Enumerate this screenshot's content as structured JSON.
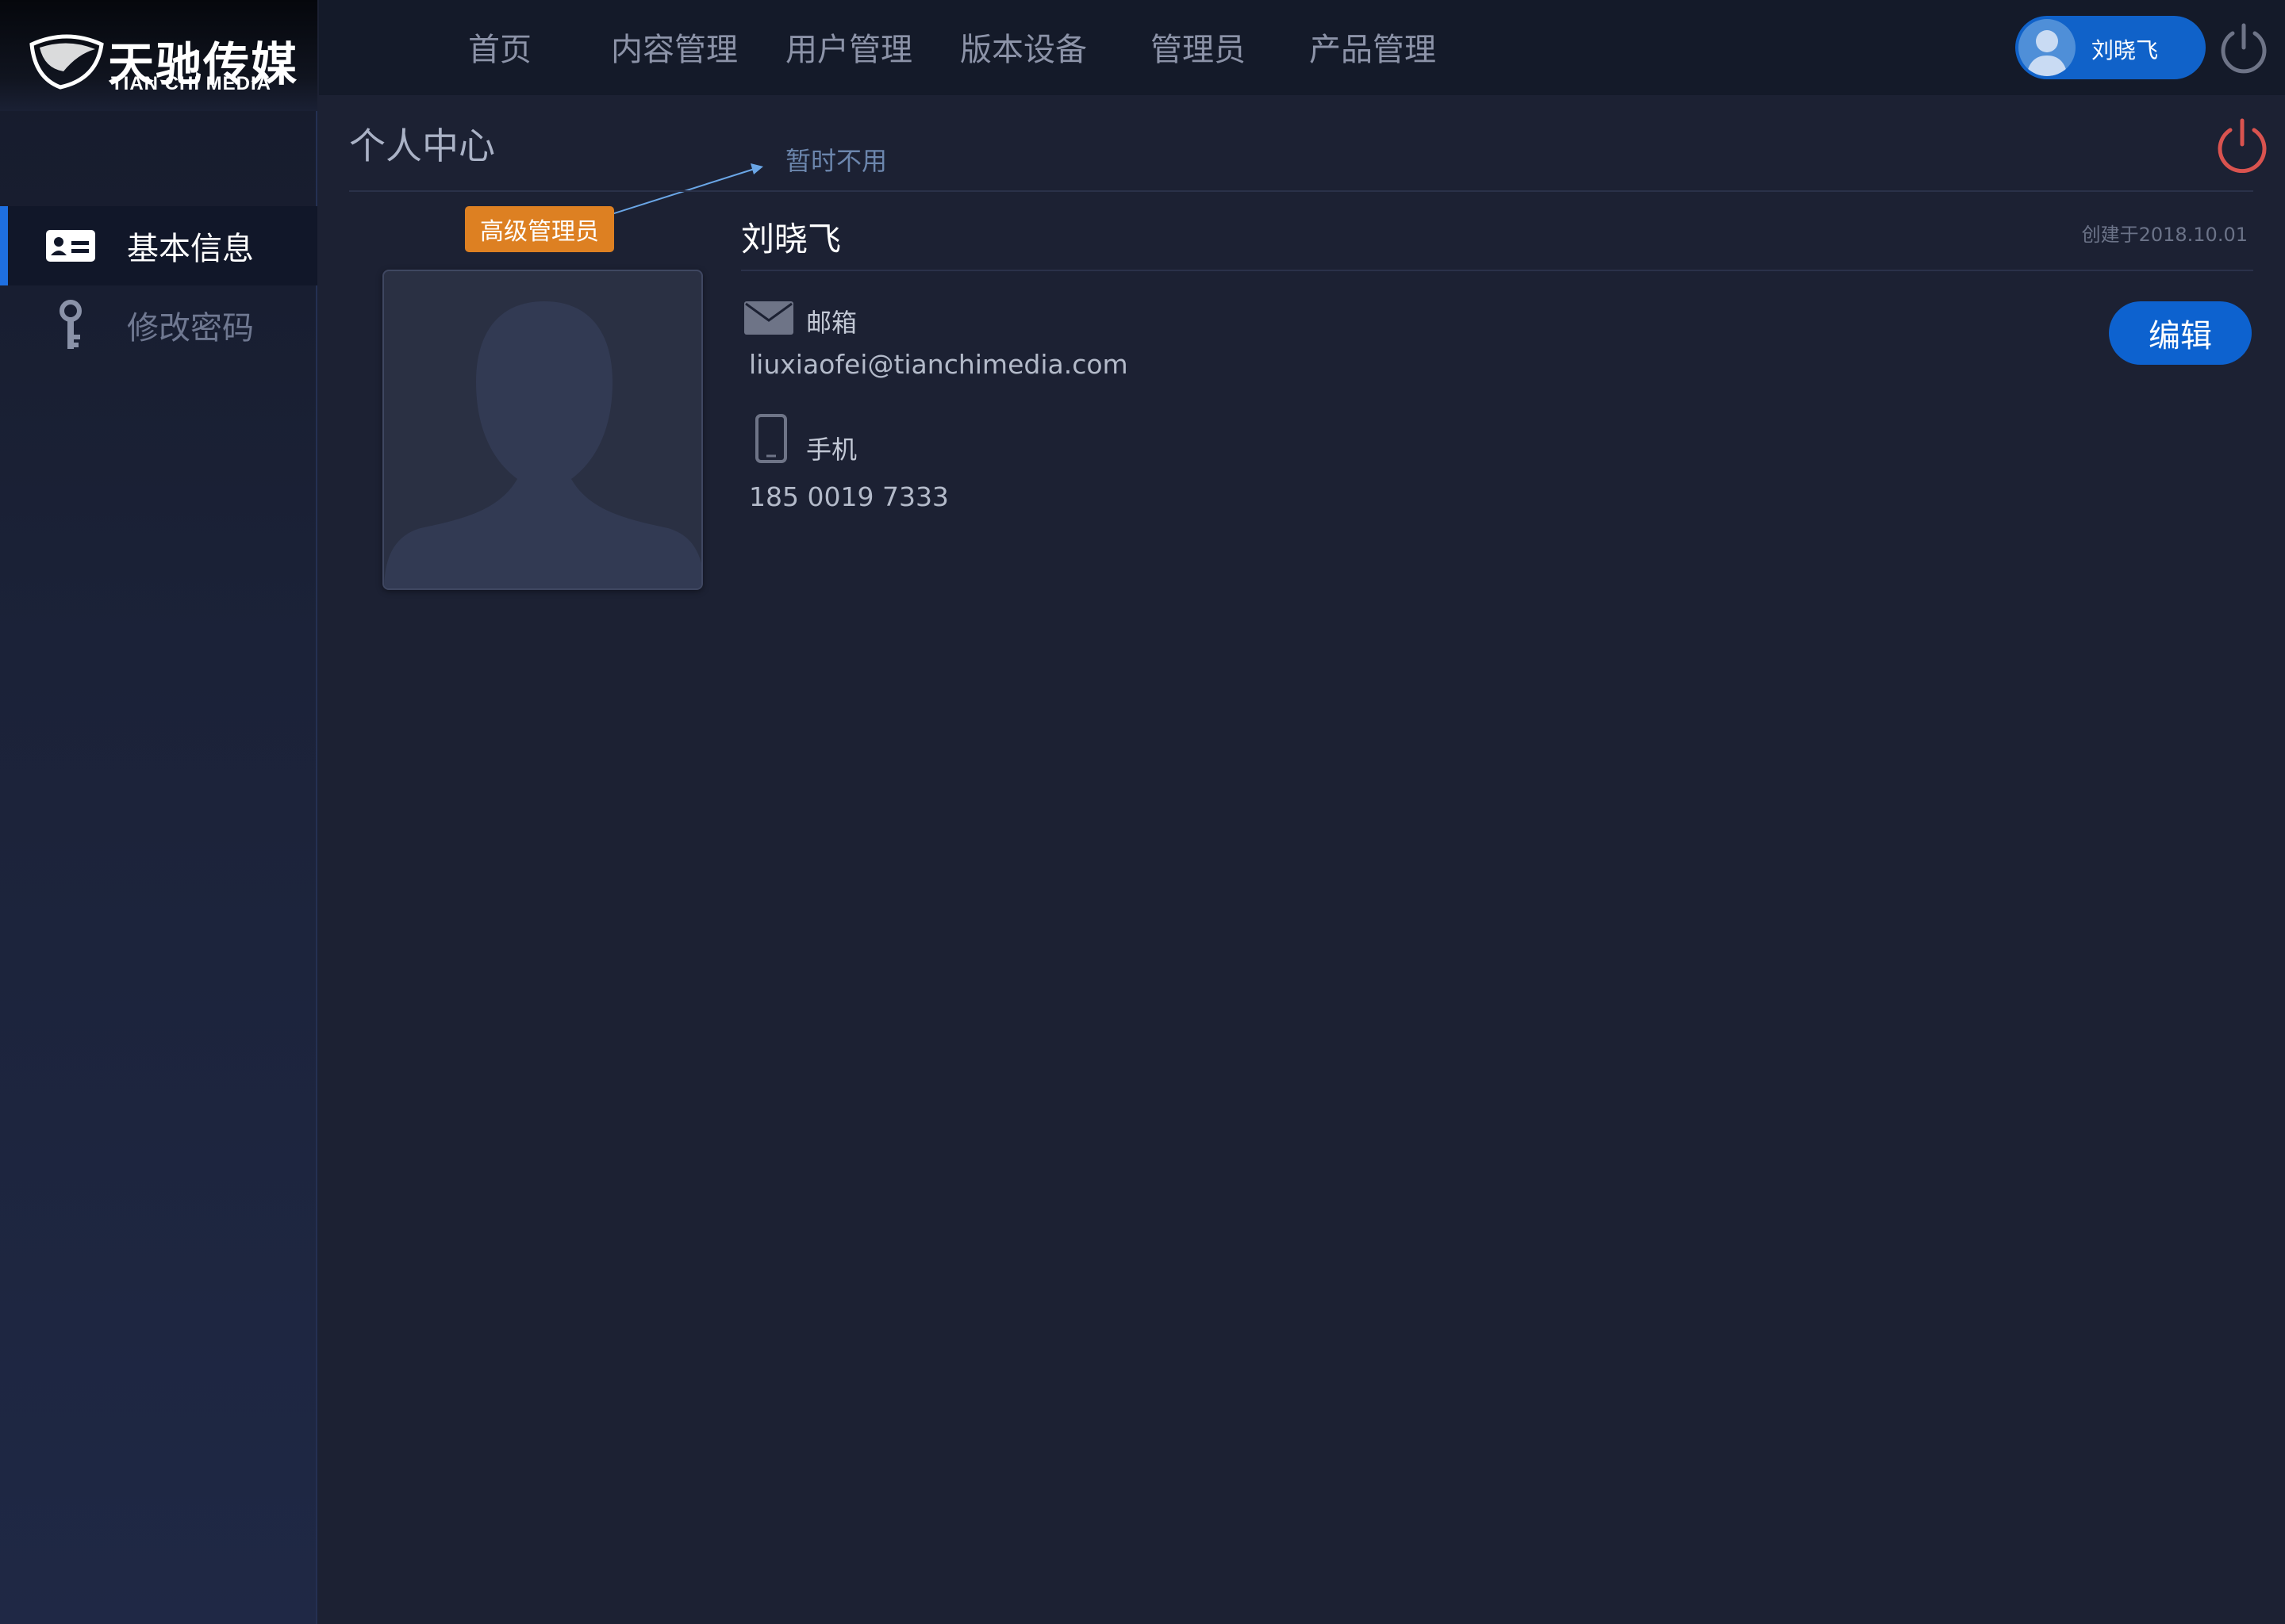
{
  "brand": {
    "name_cn": "天驰传媒",
    "name_en": "TIAN CHI MEDIA"
  },
  "sidebar": {
    "items": [
      {
        "label": "基本信息",
        "icon": "id-card-icon",
        "active": true
      },
      {
        "label": "修改密码",
        "icon": "key-icon",
        "active": false
      }
    ]
  },
  "nav": {
    "items": [
      {
        "label": "首页"
      },
      {
        "label": "内容管理"
      },
      {
        "label": "用户管理"
      },
      {
        "label": "版本设备"
      },
      {
        "label": "管理员"
      },
      {
        "label": "产品管理"
      }
    ]
  },
  "user": {
    "name": "刘晓飞"
  },
  "page": {
    "title": "个人中心",
    "note": "暂时不用"
  },
  "profile": {
    "role_badge": "高级管理员",
    "name": "刘晓飞",
    "created": "创建于2018.10.01",
    "email_label": "邮箱",
    "email": "liuxiaofei@tianchimedia.com",
    "phone_label": "手机",
    "phone": "185 0019 7333",
    "edit_label": "编辑"
  },
  "colors": {
    "accent": "#0d62cf",
    "badge": "#dd8022",
    "power_red": "#d9534f",
    "background": "#1c2133"
  }
}
